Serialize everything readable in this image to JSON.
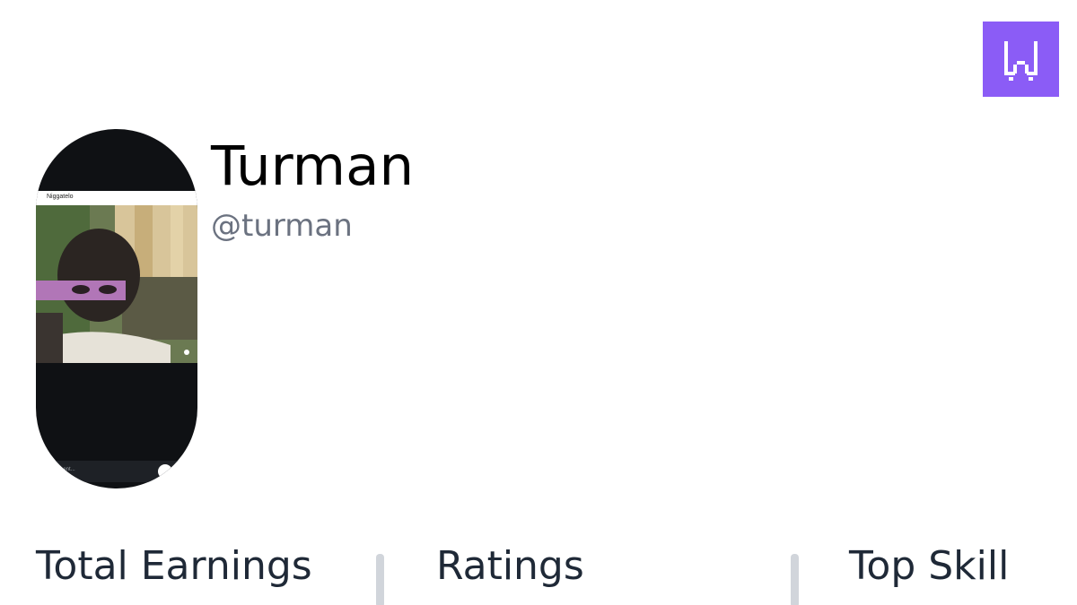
{
  "brand": {
    "logo_icon": "w-logo-icon",
    "color": "#8b5cf6"
  },
  "profile": {
    "display_name": "Turman",
    "username": "@turman",
    "avatar": {
      "overlay_title": "Niggatelo",
      "comment_placeholder": "comment..."
    }
  },
  "stats": {
    "earnings_label": "Total Earnings",
    "ratings_label": "Ratings",
    "top_skill_label": "Top Skill"
  },
  "colors": {
    "text_primary": "#000000",
    "text_heading": "#1f2937",
    "text_muted": "#6b7280",
    "divider": "#d1d5db",
    "avatar_bg": "#0f1114"
  }
}
